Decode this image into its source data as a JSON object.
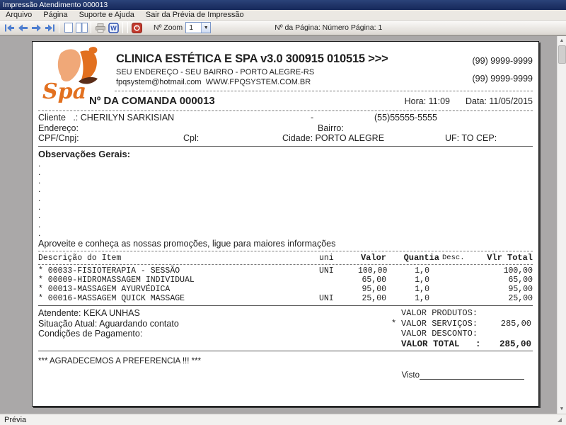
{
  "window": {
    "title": "Impressão Atendimento 000013"
  },
  "menubar": {
    "items": [
      "Arquivo",
      "Página",
      "Suporte e Ajuda",
      "Sair da Prévia de Impressão"
    ]
  },
  "toolbar": {
    "zoom_label": "Nº Zoom",
    "zoom_value": "1",
    "page_info": "Nº da Página: Número Página: 1",
    "word_icon_letter": "W"
  },
  "doc": {
    "logo_text": "Spa",
    "company_name": "CLINICA ESTÉTICA E SPA v3.0 300915 010515 >>>",
    "company_address": "SEU ENDEREÇO - SEU BAIRRO - PORTO ALEGRE-RS",
    "company_contact": "fpqsystem@hotmail.com  WWW.FPQSYSTEM.COM.BR",
    "phone1": "(99) 9999-9999",
    "phone2": "(99) 9999-9999",
    "comanda_title": "Nº DA COMANDA 000013",
    "hora": "Hora: 11:09",
    "data": "Data: 11/05/2015",
    "cliente": "Cliente   .: CHERILYN SARKISIAN",
    "cliente_sep": "-",
    "cliente_fone": "(55)55555-5555",
    "endereco": "Endereço:",
    "bairro": "Bairro:",
    "cpf": "CPF/Cnpj:",
    "cpl": "Cpl:",
    "cidade": "Cidade: PORTO ALEGRE",
    "uf_cep": "UF: TO CEP:",
    "obs_title": "Observações Gerais:",
    "obs_lines": [
      ".",
      ".",
      ".",
      ".",
      ".",
      ".",
      ".",
      ".",
      "."
    ],
    "promo": "Aproveite e conheça as nossas promoções, ligue para maiores informações",
    "table": {
      "h_desc": "Descrição do Item",
      "h_uni": "uni",
      "h_valor": "Valor",
      "h_qty": "Quantia",
      "h_disc": "Desc.",
      "h_total": "Vlr Total",
      "rows": [
        {
          "desc": "* 00033-FISIOTERAPIA - SESSÃO",
          "uni": "UNI",
          "valor": "100,00",
          "qty": "1,0",
          "disc": "",
          "total": "100,00"
        },
        {
          "desc": "* 00009-HIDROMASSAGEM INDIVIDUAL",
          "uni": "",
          "valor": "65,00",
          "qty": "1,0",
          "disc": "",
          "total": "65,00"
        },
        {
          "desc": "* 00013-MASSAGEM AYURVÉDICA",
          "uni": "",
          "valor": "95,00",
          "qty": "1,0",
          "disc": "",
          "total": "95,00"
        },
        {
          "desc": "* 00016-MASSAGEM QUICK MASSAGE",
          "uni": "UNI",
          "valor": "25,00",
          "qty": "1,0",
          "disc": "",
          "total": "25,00"
        }
      ]
    },
    "atendente": "Atendente: KEKA UNHAS",
    "situacao": "Situação Atual: Aguardando contato",
    "condicoes": "Condições de Pagamento:",
    "totals": [
      {
        "star": "",
        "label": "VALOR PRODUTOS:",
        "value": ""
      },
      {
        "star": "*",
        "label": "VALOR SERVIÇOS:",
        "value": "285,00"
      },
      {
        "star": "",
        "label": "VALOR DESCONTO:",
        "value": ""
      },
      {
        "star": "",
        "label": "VALOR TOTAL   :",
        "value": "285,00"
      }
    ],
    "thanks": "*** AGRADECEMOS A PREFERENCIA !!! ***",
    "visto_label": "Visto"
  },
  "statusbar": {
    "text": "Prévia"
  },
  "colors": {
    "accent_orange": "#e2701f",
    "face_peach": "#f0a878",
    "leaf_brown": "#5a2d18",
    "nav_blue": "#4f7fd0",
    "exit_red": "#c23a2e"
  }
}
